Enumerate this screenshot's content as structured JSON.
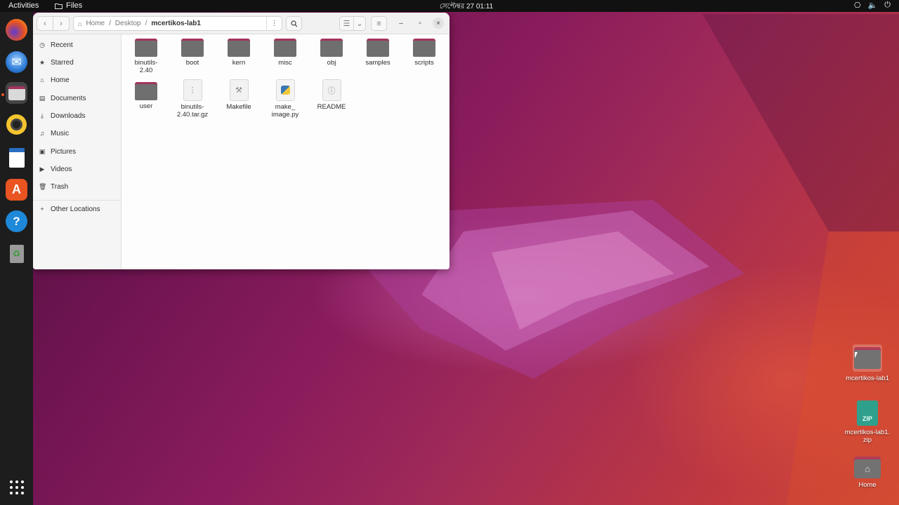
{
  "topbar": {
    "activities": "Activities",
    "app_name": "Files",
    "clock": "সেপ্টেম্বর 27  01:11"
  },
  "dock": {
    "items": [
      "firefox",
      "thunderbird",
      "files",
      "rhythmbox",
      "libreoffice-writer",
      "ubuntu-software",
      "help",
      "trash"
    ],
    "active": "files"
  },
  "window": {
    "path": [
      "Home",
      "Desktop",
      "mcertikos-lab1"
    ],
    "sidebar": [
      {
        "label": "Recent",
        "icon": "clock-icon"
      },
      {
        "label": "Starred",
        "icon": "star-icon"
      },
      {
        "label": "Home",
        "icon": "home-icon"
      },
      {
        "label": "Documents",
        "icon": "document-icon"
      },
      {
        "label": "Downloads",
        "icon": "download-icon"
      },
      {
        "label": "Music",
        "icon": "music-icon"
      },
      {
        "label": "Pictures",
        "icon": "picture-icon"
      },
      {
        "label": "Videos",
        "icon": "video-icon"
      },
      {
        "label": "Trash",
        "icon": "trash-icon"
      },
      {
        "label": "Other Locations",
        "icon": "plus-icon"
      }
    ],
    "files": [
      {
        "name": "binutils-\n2.40",
        "type": "folder"
      },
      {
        "name": "boot",
        "type": "folder"
      },
      {
        "name": "kern",
        "type": "folder"
      },
      {
        "name": "misc",
        "type": "folder"
      },
      {
        "name": "obj",
        "type": "folder"
      },
      {
        "name": "samples",
        "type": "folder"
      },
      {
        "name": "scripts",
        "type": "folder"
      },
      {
        "name": "user",
        "type": "folder"
      },
      {
        "name": "binutils-\n2.40.tar.gz",
        "type": "archive"
      },
      {
        "name": "Makefile",
        "type": "makefile"
      },
      {
        "name": "make_\nimage.py",
        "type": "python"
      },
      {
        "name": "README",
        "type": "text"
      }
    ]
  },
  "desktop": {
    "icons": [
      {
        "label": "mcertikos-lab1",
        "type": "folder"
      },
      {
        "label": "mcertikos-lab1.\nzip",
        "type": "zip"
      },
      {
        "label": "Home",
        "type": "home"
      }
    ],
    "zip_badge": "ZIP"
  }
}
